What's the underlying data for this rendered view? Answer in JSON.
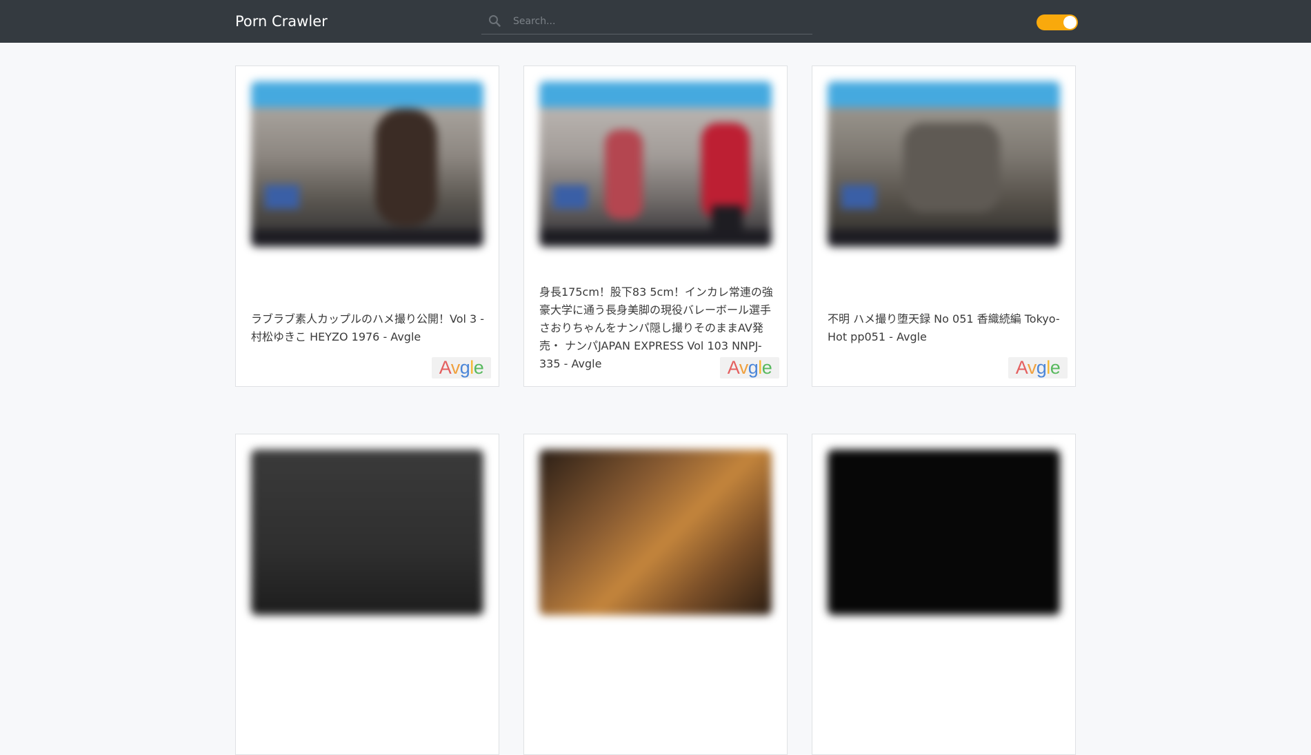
{
  "header": {
    "brand": "Porn Crawler",
    "search_placeholder": "Search...",
    "search_icon": "search-icon",
    "theme_toggle_on": true,
    "toggle_color": "#f9a90c"
  },
  "cards": [
    {
      "title": "ラブラブ素人カップルのハメ撮り公開！Vol 3 - 村松ゆきこ HEYZO 1976 - Avgle",
      "source": "Avgle"
    },
    {
      "title": "身長175cm！股下83 5cm！インカレ常連の強豪大学に通う長身美脚の現役バレーボール選手さおりちゃんをナンパ隠し撮りそのままAV発売・ ナンパJAPAN EXPRESS Vol 103 NNPJ-335 - Avgle",
      "source": "Avgle"
    },
    {
      "title": "不明 ハメ撮り堕天録 No 051 香織続編 Tokyo-Hot pp051 - Avgle",
      "source": "Avgle"
    },
    {
      "title": "",
      "source": ""
    },
    {
      "title": "",
      "source": ""
    },
    {
      "title": "",
      "source": ""
    }
  ]
}
